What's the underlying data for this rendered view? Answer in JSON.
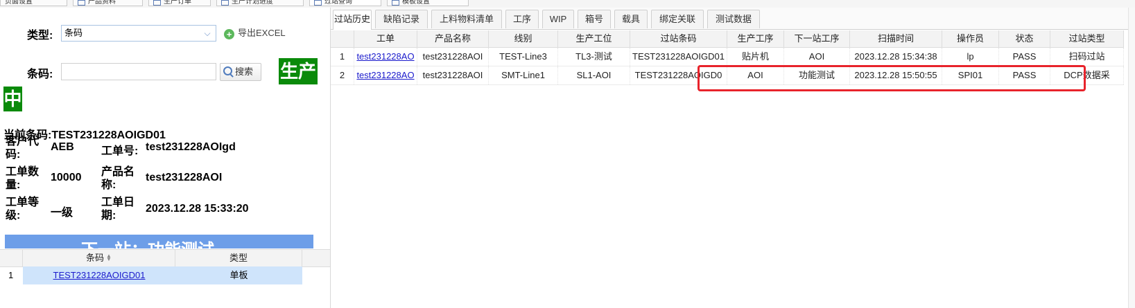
{
  "top_tabs": [
    "页面设置",
    "产品资料",
    "生产订单",
    "生产计划进度",
    "过站查询",
    "模板设置"
  ],
  "left": {
    "type_label": "类型:",
    "type_value": "条码",
    "export_label": "导出EXCEL",
    "barcode_label": "条码:",
    "barcode_value": "",
    "search_label": "搜索",
    "status_part1": "生产",
    "status_part2": "中",
    "current_label": "当前条码:",
    "current_value": "TEST231228AOIGD01",
    "info": {
      "customer_label_1": "客户代",
      "customer_label_2": "码:",
      "customer_value": "AEB",
      "wo_label": "工单号:",
      "wo_value": "test231228AOIgd",
      "qty_label_1": "工单数",
      "qty_label_2": "量:",
      "qty_value": "10000",
      "product_label_1": "产品名",
      "product_label_2": "称:",
      "product_value": "test231228AOI",
      "level_label_1": "工单等",
      "level_label_2": "级:",
      "level_value": "一级",
      "date_label_1": "工单日",
      "date_label_2": "期:",
      "date_value": "2023.12.28 15:33:20"
    },
    "next_station": "下一站：功能测试",
    "sub_table": {
      "headers": [
        "条码",
        "类型"
      ],
      "rows": [
        {
          "index": "1",
          "barcode": "TEST231228AOIGD01",
          "type": "单板"
        }
      ]
    }
  },
  "right": {
    "tabs": [
      "过站历史",
      "缺陷记录",
      "上料物料清单",
      "工序",
      "WIP",
      "箱号",
      "载具",
      "绑定关联",
      "测试数据"
    ],
    "active_tab": 0,
    "headers": [
      "工单",
      "产品名称",
      "线别",
      "生产工位",
      "过站条码",
      "生产工序",
      "下一站工序",
      "扫描时间",
      "操作员",
      "状态",
      "过站类型"
    ],
    "rows": [
      {
        "index": "1",
        "wo": "test231228AO",
        "product": "test231228AOI",
        "line": "TEST-Line3",
        "station": "TL3-测试",
        "barcode": "TEST231228AOIGD01",
        "process": "贴片机",
        "next": "AOI",
        "time": "2023.12.28 15:34:38",
        "operator": "lp",
        "status": "PASS",
        "pass_type": "扫码过站"
      },
      {
        "index": "2",
        "wo": "test231228AO",
        "product": "test231228AOI",
        "line": "SMT-Line1",
        "station": "SL1-AOI",
        "barcode": "TEST231228AOIGD0",
        "process": "AOI",
        "next": "功能测试",
        "time": "2023.12.28 15:50:55",
        "operator": "SPI01",
        "status": "PASS",
        "pass_type": "DCP数据采"
      }
    ]
  },
  "colors": {
    "status_green": "#0a8a0a",
    "banner_blue": "#6d9ee8",
    "highlight_red": "#e8232b",
    "pass_text": "#0a7a0a",
    "link": "#1a1acc"
  }
}
